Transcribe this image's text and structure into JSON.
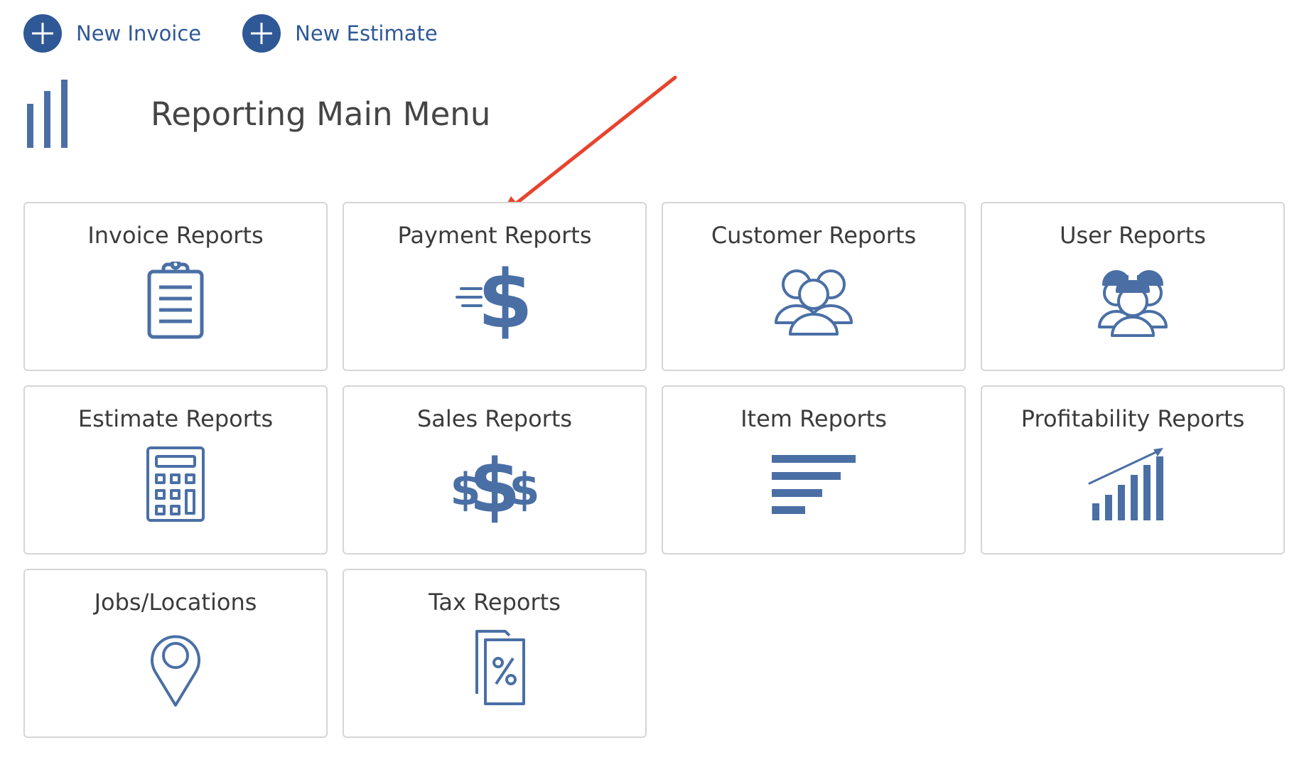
{
  "actions": {
    "new_invoice": "New Invoice",
    "new_estimate": "New Estimate"
  },
  "page": {
    "title": "Reporting Main Menu"
  },
  "tiles": [
    {
      "label": "Invoice Reports",
      "icon": "clipboard-icon"
    },
    {
      "label": "Payment Reports",
      "icon": "dollar-sign-icon"
    },
    {
      "label": "Customer Reports",
      "icon": "users-group-icon"
    },
    {
      "label": "User Reports",
      "icon": "workers-icon"
    },
    {
      "label": "Estimate Reports",
      "icon": "calculator-icon"
    },
    {
      "label": "Sales Reports",
      "icon": "dollar-signs-icon"
    },
    {
      "label": "Item Reports",
      "icon": "bars-list-icon"
    },
    {
      "label": "Profitability Reports",
      "icon": "trending-chart-icon"
    },
    {
      "label": "Jobs/Locations",
      "icon": "map-pin-icon"
    },
    {
      "label": "Tax Reports",
      "icon": "tax-documents-icon"
    }
  ],
  "colors": {
    "accent": "#2f5896",
    "icon": "#4a6fa5",
    "annotation_arrow": "#e8432d",
    "tile_border": "#d6d6d6"
  }
}
